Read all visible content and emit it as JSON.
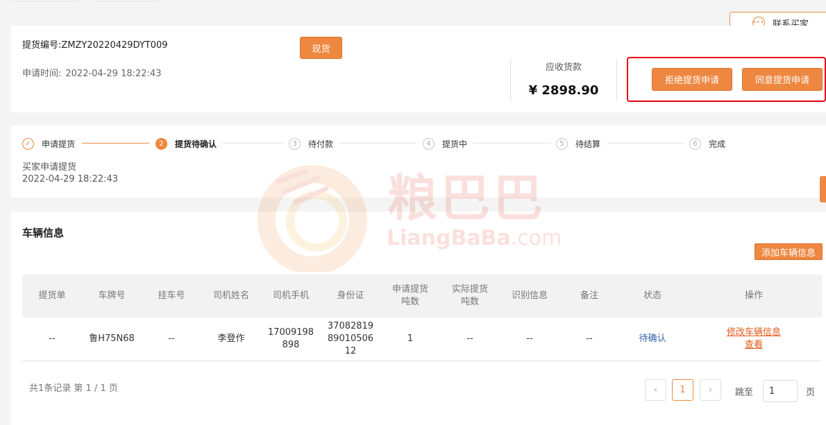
{
  "contact_button": "联系买家",
  "contact_icon": "chat-bubble-icon",
  "order": {
    "number_label": "提货编号:",
    "number": "ZMZY20220429DYT009",
    "tag": "现货",
    "time_label": "申请时间:",
    "time": "2022-04-29 18:22:43",
    "receivable_label": "应收货款",
    "receivable_amount": "¥ 2898.90",
    "reject_button": "拒绝提货申请",
    "approve_button": "同意提货申请"
  },
  "steps": [
    {
      "num": "✓",
      "label": "申请提货",
      "state": "done"
    },
    {
      "num": "2",
      "label": "提货待确认",
      "state": "active"
    },
    {
      "num": "3",
      "label": "待付款",
      "state": "pending"
    },
    {
      "num": "4",
      "label": "提货中",
      "state": "pending"
    },
    {
      "num": "5",
      "label": "待结算",
      "state": "pending"
    },
    {
      "num": "6",
      "label": "完成",
      "state": "pending"
    }
  ],
  "step_desc": {
    "line1": "买家申请提货",
    "line2": "2022-04-29 18:22:43"
  },
  "vehicle": {
    "title": "车辆信息",
    "add_button": "添加车辆信息",
    "columns": [
      "提货单",
      "车牌号",
      "挂车号",
      "司机姓名",
      "司机手机",
      "身份证",
      "申请提货\n吨数",
      "实际提货\n吨数",
      "识别信息",
      "备注",
      "状态",
      "操作"
    ],
    "rows": [
      {
        "bill": "--",
        "plate": "鲁H75N68",
        "trailer": "--",
        "driver": "李登作",
        "phone": "17009198\n898",
        "id_card": "37082819\n89010506\n12",
        "apply_tons": "1",
        "actual_tons": "--",
        "recognition": "--",
        "remark": "--",
        "status": "待确认",
        "op_edit": "修改车辆信息",
        "op_view": "查看"
      }
    ]
  },
  "pagination": {
    "summary": "共1条记录 第 1 / 1 页",
    "prev": "‹",
    "current": "1",
    "next": "›",
    "jump_label": "跳至",
    "jump_value": "1",
    "page_word": "页"
  },
  "watermark": {
    "cn": "粮巴巴",
    "en": "LiangBaBa",
    "domain": ".com"
  },
  "colors": {
    "accent": "#ee8740",
    "highlight_border": "#e60012",
    "status_link": "#3a62ad",
    "op_link": "#e45a19"
  }
}
